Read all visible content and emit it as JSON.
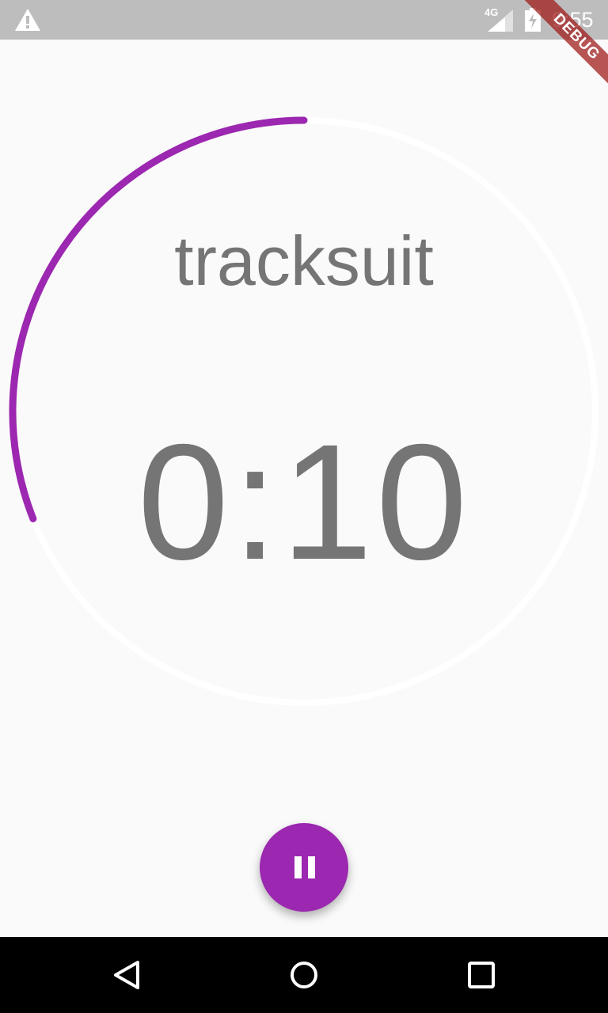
{
  "status_bar": {
    "network_label": "4G",
    "time": "9:55",
    "icons": [
      "warning-icon",
      "signal-icon",
      "battery-charging-icon"
    ]
  },
  "debug_banner": "DEBUG",
  "timer": {
    "label": "tracksuit",
    "time_remaining": "0:10",
    "progress_fraction": 0.31,
    "progress_color": "#9c27b0",
    "track_color": "#ffffff"
  },
  "fab": {
    "icon": "pause-icon",
    "color": "#9c27b0"
  },
  "nav_bar": {
    "icons": [
      "back-icon",
      "home-icon",
      "recents-icon"
    ]
  }
}
